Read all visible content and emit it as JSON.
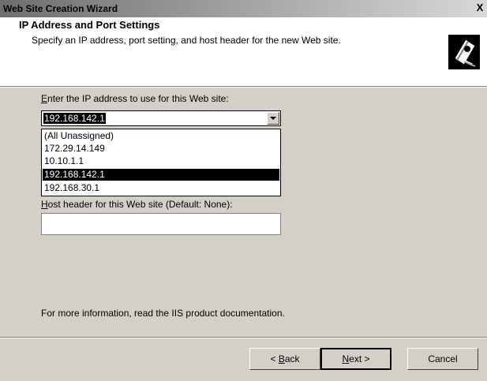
{
  "window": {
    "title": "Web Site Creation Wizard",
    "close_label": "X"
  },
  "header": {
    "title": "IP Address and Port Settings",
    "subtitle": "Specify an IP address, port setting, and host header for the new Web site.",
    "icon": "wizard-book-icon"
  },
  "ip": {
    "label_prefix": "",
    "label_accel": "E",
    "label_rest": "nter the IP address to use for this Web site:",
    "selected": "192.168.142.1",
    "options": [
      "(All Unassigned)",
      "172.29.14.149",
      "10.10.1.1",
      "192.168.142.1",
      "192.168.30.1"
    ]
  },
  "host": {
    "label_accel": "H",
    "label_rest": "ost header for this Web site (Default: None):",
    "value": ""
  },
  "info_text": "For more information, read the IIS product documentation.",
  "buttons": {
    "back_prefix": "< ",
    "back_accel": "B",
    "back_rest": "ack",
    "next_accel": "N",
    "next_rest": "ext >",
    "cancel": "Cancel"
  }
}
